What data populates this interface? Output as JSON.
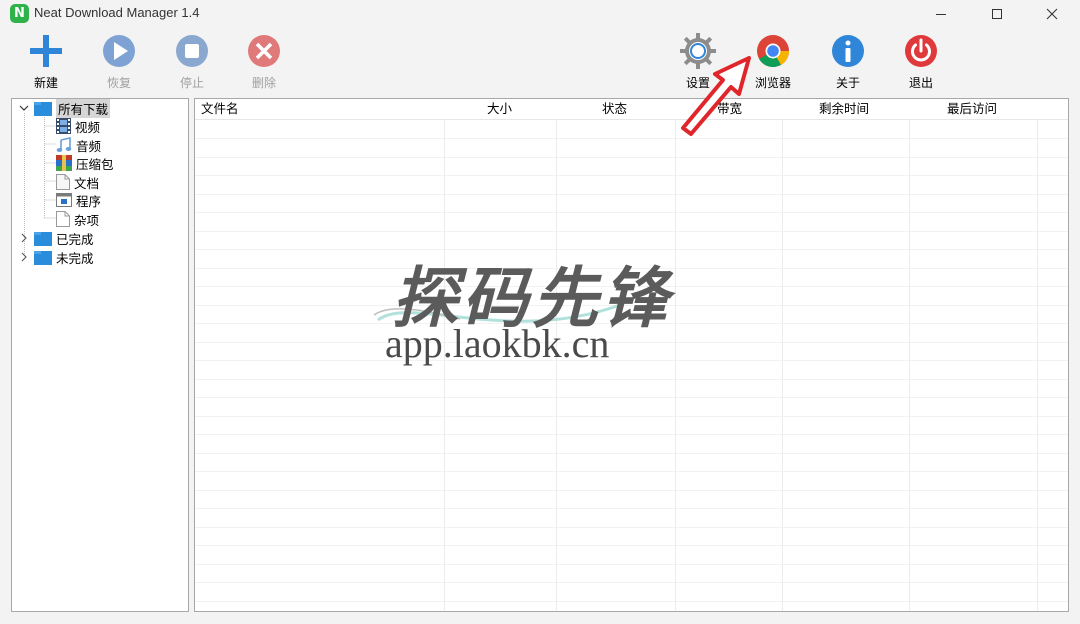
{
  "window": {
    "title": "Neat Download Manager 1.4",
    "logo_letter": "N"
  },
  "toolbar": {
    "new": "新建",
    "resume": "恢复",
    "stop": "停止",
    "delete": "删除",
    "settings": "设置",
    "browser": "浏览器",
    "about": "关于",
    "exit": "退出"
  },
  "tree": {
    "root": "所有下载",
    "categories": [
      "视频",
      "音频",
      "压缩包",
      "文档",
      "程序",
      "杂项"
    ],
    "completed": "已完成",
    "incomplete": "未完成"
  },
  "list": {
    "columns": [
      "文件名",
      "大小",
      "状态",
      "带宽",
      "剩余时间",
      "最后访问"
    ]
  },
  "watermark": {
    "title": "探码先锋",
    "url": "app.laokbk.cn"
  },
  "colors": {
    "accent_blue": "#2f86d8",
    "exit_red": "#e0393c",
    "delete_red": "#e07a7a",
    "logo_green": "#2fb24a",
    "arrow_red": "#e0262b"
  }
}
